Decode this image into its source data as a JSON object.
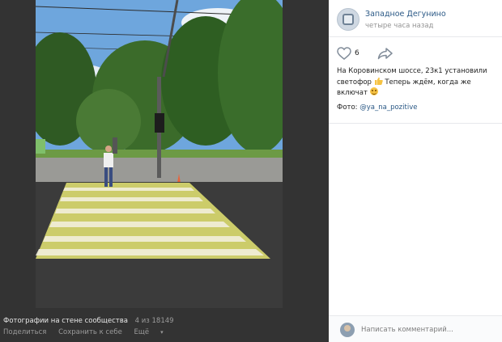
{
  "viewer": {
    "album_title": "Фотографии на стене сообщества",
    "counter": "4 из 18149",
    "actions": {
      "share": "Поделиться",
      "save": "Сохранить к себе",
      "more": "Ещё"
    },
    "photo_description": "street crosswalk with a man standing, traffic light, trees"
  },
  "post": {
    "owner_name": "Западное Дегунино",
    "time": "четыре часа назад",
    "likes_count": "6",
    "text_part1": "На Коровинском шоссе, 23к1 установили светофор",
    "text_part2": "Теперь ждём, когда же включат",
    "credit_label": "Фото:",
    "credit_link": "@ya_na_pozitive"
  },
  "comment": {
    "placeholder": "Написать комментарий..."
  },
  "icons": {
    "like": "heart-icon",
    "share": "share-arrow-icon",
    "thumbs_up": "thumbs-up-emoji",
    "smile": "smile-emoji"
  },
  "colors": {
    "link": "#2a5885",
    "viewer_bg": "#333333",
    "panel_bg": "#ffffff"
  }
}
